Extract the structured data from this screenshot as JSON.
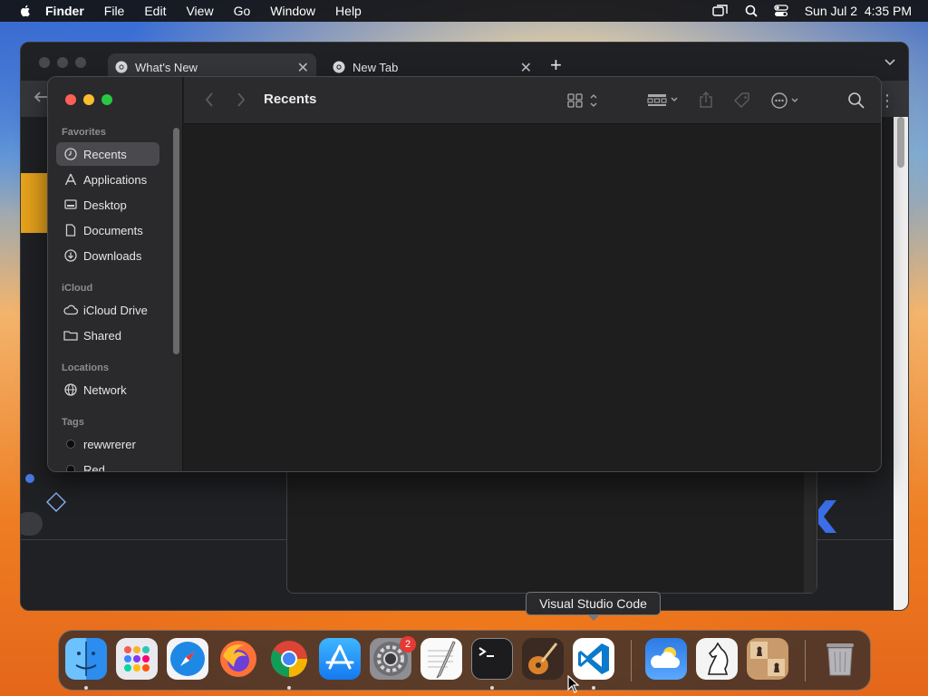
{
  "menubar": {
    "app_name": "Finder",
    "items": [
      "File",
      "Edit",
      "View",
      "Go",
      "Window",
      "Help"
    ],
    "clock": "Sun Jul 2  4:35 PM",
    "status_icons": [
      "screen-mirroring-icon",
      "spotlight-search-icon",
      "control-center-icon"
    ]
  },
  "chrome": {
    "tabs": [
      {
        "label": "What's New",
        "active": true
      },
      {
        "label": "New Tab",
        "active": false
      }
    ],
    "new_tab_symbol": "+",
    "close_symbol": "✕",
    "menu_symbol": "⋮"
  },
  "finder": {
    "title": "Recents",
    "sections": {
      "favorites": "Favorites",
      "icloud": "iCloud",
      "locations": "Locations",
      "tags": "Tags"
    },
    "favorites": [
      {
        "label": "Recents",
        "icon": "clock-icon",
        "selected": true
      },
      {
        "label": "Applications",
        "icon": "applications-icon"
      },
      {
        "label": "Desktop",
        "icon": "desktop-icon"
      },
      {
        "label": "Documents",
        "icon": "document-icon"
      },
      {
        "label": "Downloads",
        "icon": "download-icon"
      }
    ],
    "icloud": [
      {
        "label": "iCloud Drive",
        "icon": "cloud-icon"
      },
      {
        "label": "Shared",
        "icon": "shared-folder-icon"
      }
    ],
    "locations": [
      {
        "label": "Network",
        "icon": "globe-icon"
      }
    ],
    "tags": [
      {
        "label": "rewwrerer",
        "color": "#0c0c0c"
      },
      {
        "label": "Red",
        "color": "#0c0c0c"
      }
    ]
  },
  "dock": {
    "tooltip": "Visual Studio Code",
    "apps": [
      "Finder",
      "Launchpad",
      "Safari",
      "Firefox",
      "Google Chrome",
      "App Store",
      "System Settings",
      "TextEdit",
      "Terminal",
      "GarageBand",
      "Visual Studio Code",
      "Weather",
      "Chess",
      "Chess Board",
      "Trash"
    ],
    "settings_badge": "2"
  },
  "colors": {
    "close": "#fe5f57",
    "minimize": "#febc2e",
    "zoom": "#28c840",
    "accent_blue": "#0a84ff"
  }
}
